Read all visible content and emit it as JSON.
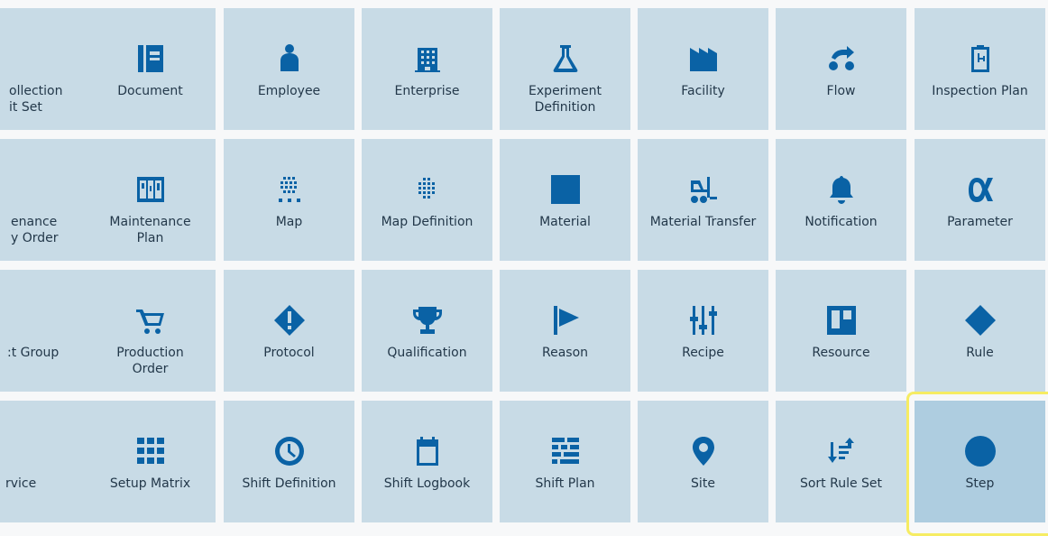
{
  "row1": [
    "ollection\nit Set",
    "Document",
    "Employee",
    "Enterprise",
    "Experiment\nDefinition",
    "Facility",
    "Flow",
    "Inspection Plan"
  ],
  "row2": [
    "enance\ny Order",
    "Maintenance\nPlan",
    "Map",
    "Map Definition",
    "Material",
    "Material Transfer",
    "Notification",
    "Parameter"
  ],
  "row3": [
    ":t Group",
    "Production\nOrder",
    "Protocol",
    "Qualification",
    "Reason",
    "Recipe",
    "Resource",
    "Rule"
  ],
  "row4": [
    "rvice",
    "Setup Matrix",
    "Shift Definition",
    "Shift Logbook",
    "Shift Plan",
    "Site",
    "Sort Rule Set",
    "Step"
  ],
  "selected_tile": "Step",
  "colors": {
    "tile": "#c8dbe6",
    "selected_tile": "#aecde0",
    "icon": "#0a62a5",
    "highlight": "#f6ec63"
  }
}
